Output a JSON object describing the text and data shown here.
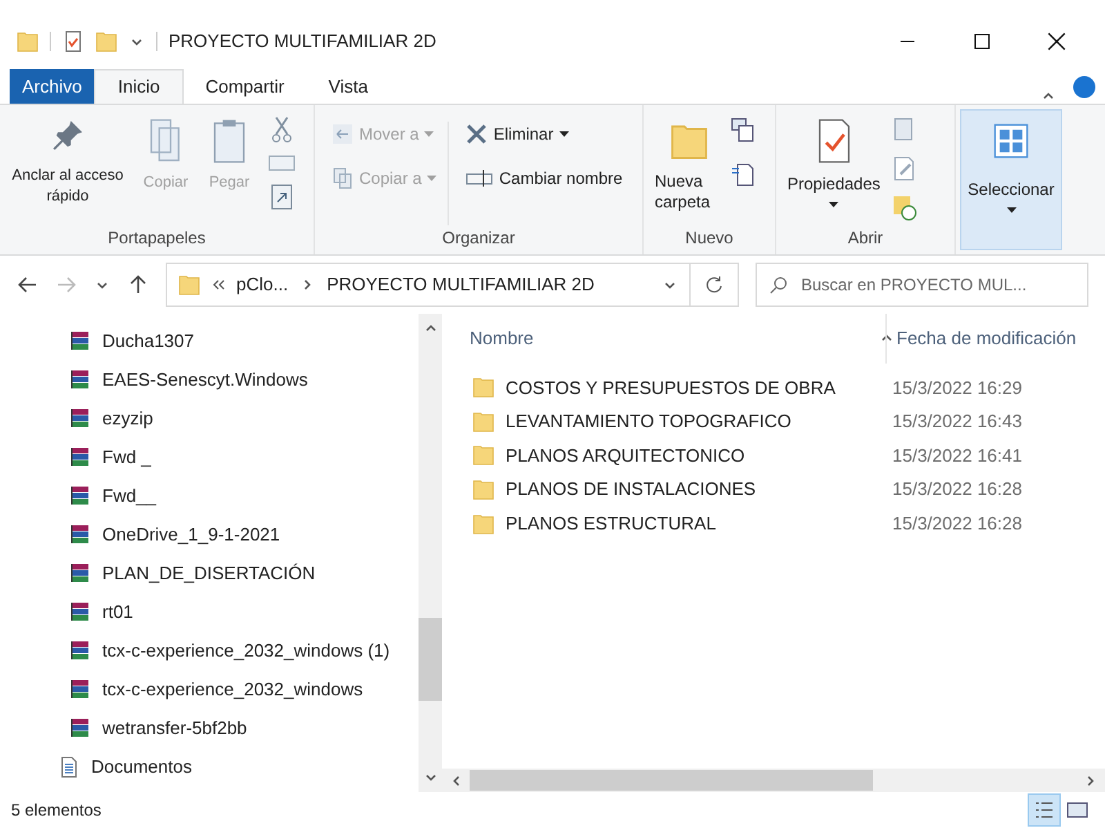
{
  "window": {
    "title": "PROYECTO MULTIFAMILIAR 2D"
  },
  "ribbon_tabs": [
    {
      "label": "Archivo",
      "kind": "file",
      "selected": false
    },
    {
      "label": "Inicio",
      "kind": "tab",
      "selected": true
    },
    {
      "label": "Compartir",
      "kind": "tab",
      "selected": false
    },
    {
      "label": "Vista",
      "kind": "tab",
      "selected": false
    }
  ],
  "ribbon_groups": [
    {
      "label": "Portapapeles",
      "items": [
        {
          "label": "Anclar al acceso rápido",
          "disabled": false
        },
        {
          "label": "Copiar",
          "disabled": true
        },
        {
          "label": "Pegar",
          "disabled": true
        }
      ]
    },
    {
      "label": "Organizar",
      "items": [
        {
          "label": "Mover a",
          "disabled": true
        },
        {
          "label": "Copiar a",
          "disabled": true
        },
        {
          "label": "Eliminar",
          "disabled": false
        },
        {
          "label": "Cambiar nombre",
          "disabled": false
        }
      ]
    },
    {
      "label": "Nuevo",
      "items": [
        {
          "label": "Nueva carpeta",
          "disabled": false
        }
      ]
    },
    {
      "label": "Abrir",
      "items": [
        {
          "label": "Propiedades",
          "disabled": false
        }
      ]
    },
    {
      "items": [
        {
          "label": "Seleccionar",
          "disabled": false
        }
      ]
    }
  ],
  "address": {
    "path": [
      "pClo...",
      "PROYECTO MULTIFAMILIAR 2D"
    ]
  },
  "search": {
    "placeholder": "Buscar en PROYECTO MUL..."
  },
  "sidebar": {
    "items": [
      {
        "label": "Ducha1307",
        "kind": "archive"
      },
      {
        "label": "EAES-Senescyt.Windows",
        "kind": "archive"
      },
      {
        "label": "ezyzip",
        "kind": "archive"
      },
      {
        "label": "Fwd _",
        "kind": "archive"
      },
      {
        "label": "Fwd__",
        "kind": "archive"
      },
      {
        "label": "OneDrive_1_9-1-2021",
        "kind": "archive"
      },
      {
        "label": "PLAN_DE_DISERTACIÓN",
        "kind": "archive"
      },
      {
        "label": "rt01",
        "kind": "archive"
      },
      {
        "label": "tcx-c-experience_2032_windows (1)",
        "kind": "archive"
      },
      {
        "label": "tcx-c-experience_2032_windows",
        "kind": "archive"
      },
      {
        "label": "wetransfer-5bf2bb",
        "kind": "archive"
      },
      {
        "label": "Documentos",
        "kind": "documents"
      }
    ]
  },
  "table": {
    "columns": [
      "Nombre",
      "Fecha de modificación"
    ],
    "rows": [
      {
        "name": "COSTOS Y PRESUPUESTOS DE OBRA",
        "date": "15/3/2022 16:29"
      },
      {
        "name": "LEVANTAMIENTO TOPOGRAFICO",
        "date": "15/3/2022 16:43"
      },
      {
        "name": "PLANOS ARQUITECTONICO",
        "date": "15/3/2022 16:41"
      },
      {
        "name": "PLANOS DE INSTALACIONES",
        "date": "15/3/2022 16:28"
      },
      {
        "name": "PLANOS ESTRUCTURAL",
        "date": "15/3/2022 16:28"
      }
    ]
  },
  "status_bar": {
    "text": "5 elementos"
  },
  "views": [
    {
      "kind": "details",
      "selected": true
    },
    {
      "kind": "large",
      "selected": false
    }
  ]
}
